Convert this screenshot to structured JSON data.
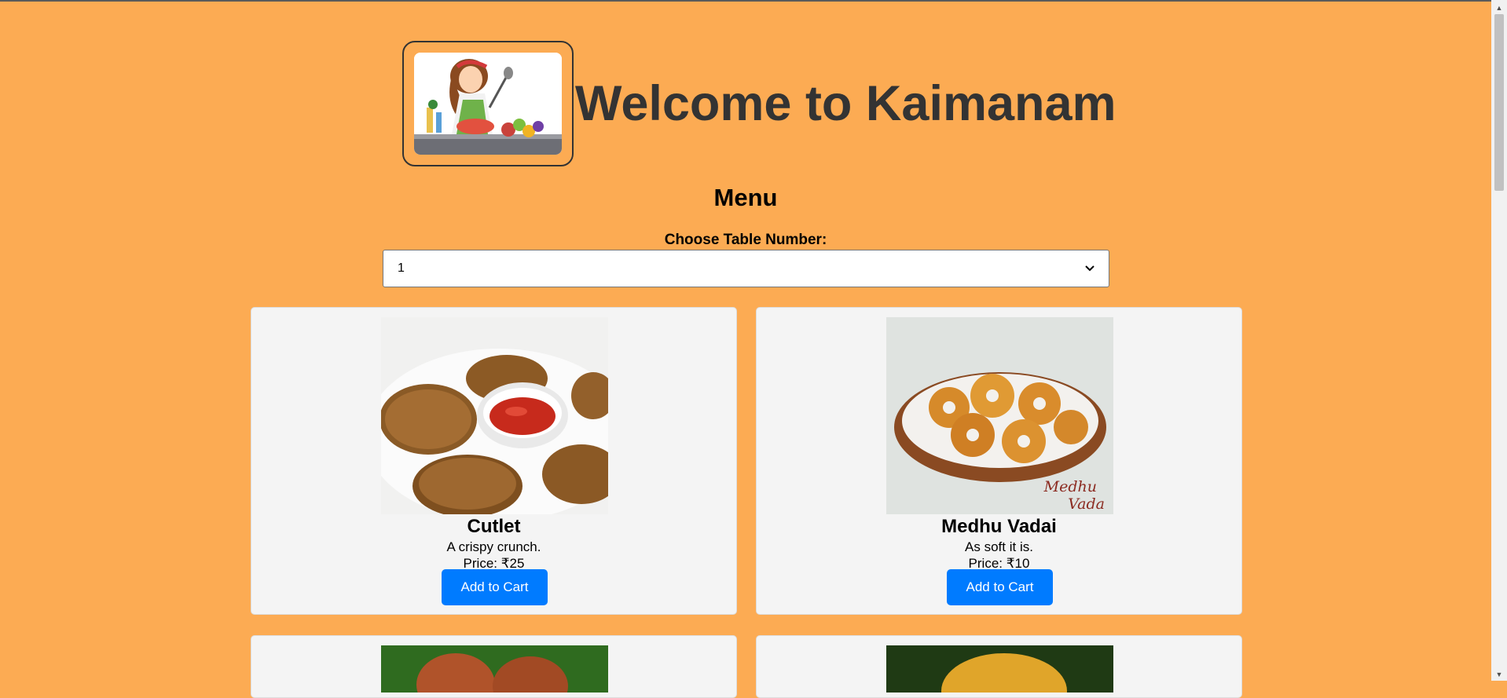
{
  "header": {
    "title": "Welcome to Kaimanam",
    "logo_icon": "chef-cooking-illustration"
  },
  "menu": {
    "heading": "Menu"
  },
  "table_select": {
    "label": "Choose Table Number:",
    "selected": "1"
  },
  "items": [
    {
      "name": "Cutlet",
      "description": "A crispy crunch.",
      "price": "Price: ₹25",
      "button": "Add to Cart",
      "image_icon": "cutlet-photo"
    },
    {
      "name": "Medhu Vadai",
      "description": "As soft it is.",
      "price": "Price: ₹10",
      "button": "Add to Cart",
      "image_icon": "vadai-photo",
      "image_caption": "Medhu Vada"
    }
  ],
  "colors": {
    "page_bg": "#fcab53",
    "title": "#333333",
    "button": "#007bff",
    "card_bg": "#f4f4f4"
  }
}
